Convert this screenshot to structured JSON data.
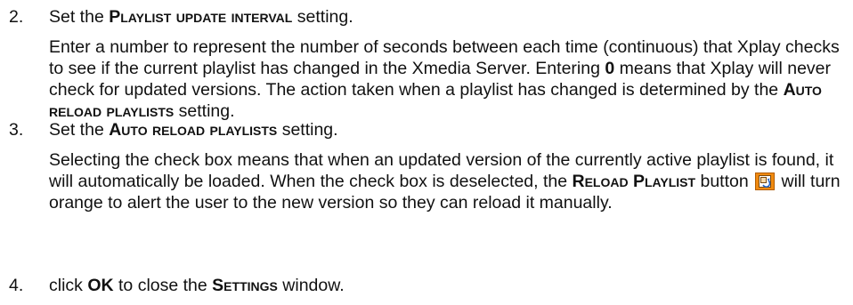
{
  "steps": [
    {
      "number": "2.",
      "head_prefix": "Set the ",
      "head_setting": "Playlist update interval",
      "head_suffix": " setting.",
      "body_1": "Enter a number to represent the number of seconds between each time (continuous) that Xplay checks to see if the current playlist has changed in the Xmedia Server. Entering ",
      "body_bold": "0",
      "body_2": " means that Xplay will never check for updated versions. The action taken when a playlist has changed is determined by the ",
      "body_setting": "Auto reload playlists",
      "body_3": " setting."
    },
    {
      "number": "3.",
      "head_prefix": "Set the ",
      "head_setting": "Auto reload playlists",
      "head_suffix": " setting.",
      "body_1": "Selecting the check box means that when an updated version of the currently active playlist is found, it will automatically be loaded. When the check box is deselected, the ",
      "body_setting": "Reload Playlist",
      "body_2": " button ",
      "icon": "reload-playlist-icon",
      "body_3": " will turn orange to alert the user to the new version so they can reload it manually."
    },
    {
      "number": "4.",
      "text_1": "click ",
      "text_bold": "OK",
      "text_2": " to close the ",
      "text_setting": "Settings",
      "text_3": " window."
    }
  ],
  "colors": {
    "icon_fill": "#f08a10",
    "icon_border": "#b35d00"
  }
}
